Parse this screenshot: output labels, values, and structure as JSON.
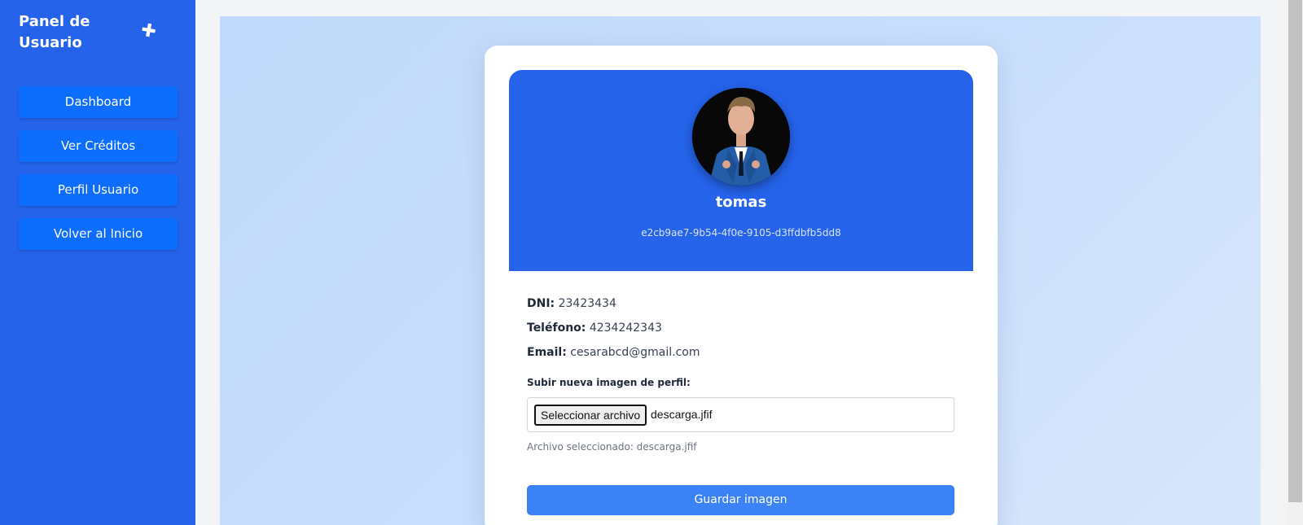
{
  "sidebar": {
    "title": "Panel de Usuario",
    "toggle_icon": "pin-icon",
    "items": [
      {
        "label": "Dashboard"
      },
      {
        "label": "Ver Créditos"
      },
      {
        "label": "Perfil Usuario"
      },
      {
        "label": "Volver al Inicio"
      }
    ]
  },
  "profile": {
    "username": "tomas",
    "user_id": "e2cb9ae7-9b54-4f0e-9105-d3ffdbfb5dd8",
    "avatar_icon": "user-photo",
    "dni_label": "DNI:",
    "dni": "23423434",
    "phone_label": "Teléfono:",
    "phone": "4234242343",
    "email_label": "Email:",
    "email": "cesarabcd@gmail.com"
  },
  "upload": {
    "label": "Subir nueva imagen de perfil:",
    "button_label": "Seleccionar archivo",
    "file_name": "descarga.jfif",
    "selected_text": "Archivo seleccionado: descarga.jfif",
    "save_label": "Guardar imagen"
  },
  "colors": {
    "sidebar": "#2563eb",
    "nav_button": "#0d6efd",
    "profile_header": "#2563eb",
    "save_button": "#3b82f6"
  }
}
